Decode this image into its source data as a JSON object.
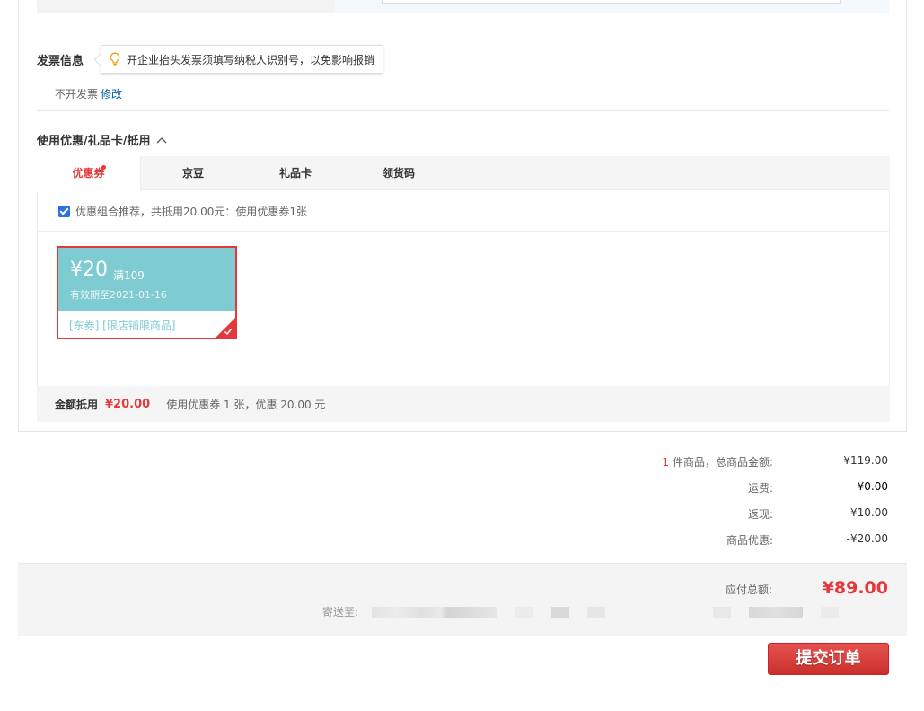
{
  "invoice": {
    "title": "发票信息",
    "tip": "开企业抬头发票须填写纳税人识别号，以免影响报销",
    "status": "不开发票",
    "modify": "修改"
  },
  "coupon": {
    "title": "使用优惠/礼品卡/抵用",
    "tabs": [
      "优惠券",
      "京豆",
      "礼品卡",
      "领货码"
    ],
    "combo_text": "优惠组合推荐，共抵用20.00元：使用优惠券1张",
    "card": {
      "amount": "¥20",
      "condition": "满109",
      "valid": "有效期至2021-01-16",
      "tags": "[东券] [限店铺限商品]"
    },
    "footer": {
      "label": "金额抵用",
      "amount": "¥20.00",
      "desc": "使用优惠券 1 张，优惠 20.00 元"
    }
  },
  "summary": {
    "item_count": "1",
    "items_label": "件商品，总商品金额:",
    "items_value": "¥119.00",
    "shipping_label": "运费:",
    "shipping_value": "¥0.00",
    "cashback_label": "返现:",
    "cashback_value": "-¥10.00",
    "discount_label": "商品优惠:",
    "discount_value": "-¥20.00"
  },
  "total": {
    "label": "应付总额:",
    "value": "¥89.00",
    "ship_to_label": "寄送至:"
  },
  "submit_label": "提交订单",
  "colors": {
    "accent": "#e4393c",
    "link": "#005aa0",
    "coupon_teal": "#7ecbd2"
  }
}
